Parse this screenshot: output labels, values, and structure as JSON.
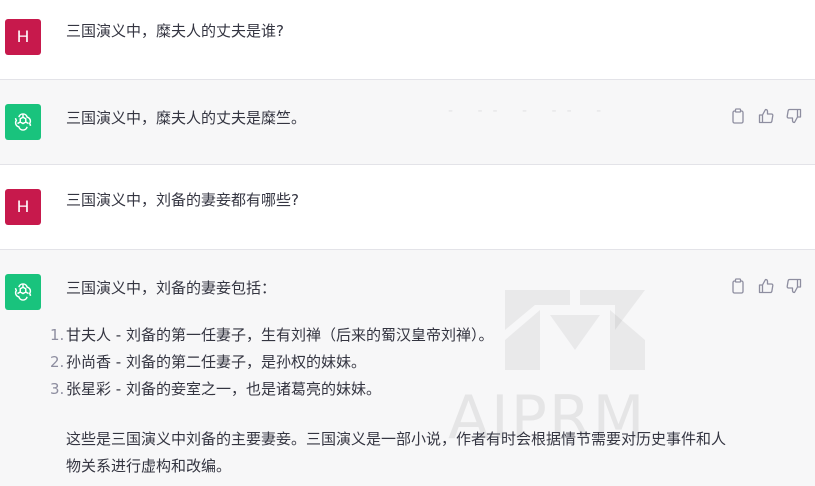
{
  "conversation": [
    {
      "role": "user",
      "avatar_letter": "H",
      "text": "三国演义中，糜夫人的丈夫是谁?"
    },
    {
      "role": "assistant",
      "text": "三国演义中，糜夫人的丈夫是糜竺。",
      "actions": [
        "copy-icon",
        "thumbs-up-icon",
        "thumbs-down-icon"
      ]
    },
    {
      "role": "user",
      "avatar_letter": "H",
      "text": "三国演义中，刘备的妻妾都有哪些?"
    },
    {
      "role": "assistant",
      "intro": "三国演义中，刘备的妻妾包括：",
      "list": [
        {
          "num": "1.",
          "text": "甘夫人 - 刘备的第一任妻子，生有刘禅（后来的蜀汉皇帝刘禅）。"
        },
        {
          "num": "2.",
          "text": "孙尚香 - 刘备的第二任妻子，是孙权的妹妹。"
        },
        {
          "num": "3.",
          "text": "张星彩 - 刘备的妾室之一，也是诸葛亮的妹妹。"
        }
      ],
      "summary": "这些是三国演义中刘备的主要妻妾。三国演义是一部小说，作者有时会根据情节需要对历史事件和人物关系进行虚构和改编。",
      "actions": [
        "copy-icon",
        "thumbs-up-icon",
        "thumbs-down-icon"
      ]
    }
  ],
  "watermark": {
    "text": "AIPRM",
    "dashes": "- -- - --  -"
  },
  "colors": {
    "user_avatar": "#c7194c",
    "assistant_avatar": "#19c37d",
    "assistant_bg": "#f7f7f8",
    "text": "#343541"
  }
}
